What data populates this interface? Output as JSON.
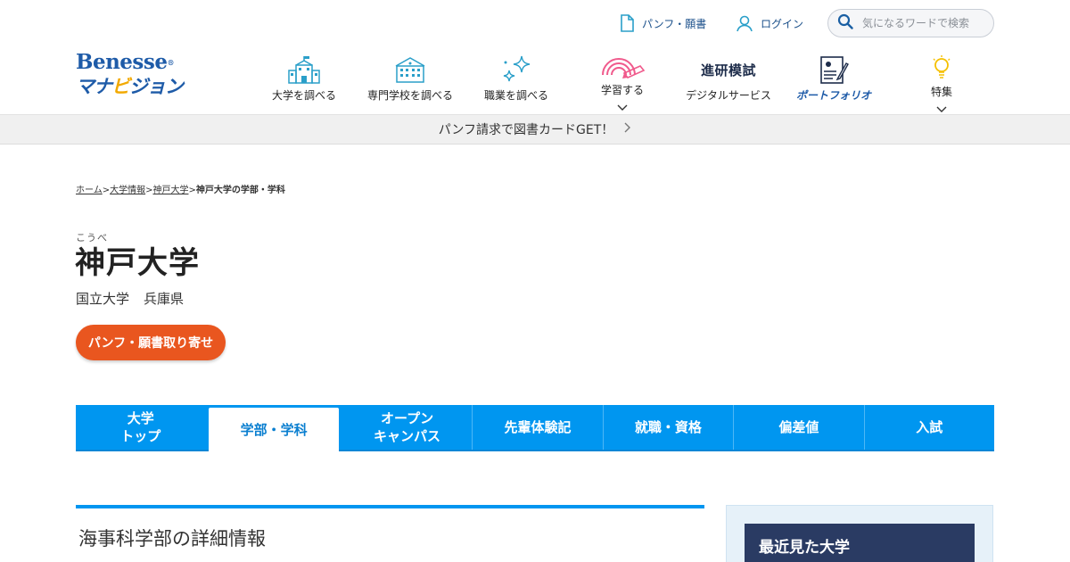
{
  "utility": {
    "pamphlet_label": "パンフ・願書",
    "login_label": "ログイン",
    "search_placeholder": "気になるワードで検索"
  },
  "logo": {
    "top": "Benesse",
    "reg": "®",
    "bottom_a": "マナ",
    "bottom_b": "ビ",
    "bottom_c": "ジョン"
  },
  "nav": {
    "items": [
      {
        "label": "大学を調べる",
        "icon": "school-building-icon"
      },
      {
        "label": "専門学校を調べる",
        "icon": "college-building-icon"
      },
      {
        "label": "職業を調べる",
        "icon": "sparkle-icon"
      },
      {
        "label": "学習する",
        "icon": "rainbow-pencil-icon",
        "dropdown": true
      },
      {
        "label": "デジタルサービス",
        "brand": "進研模試"
      },
      {
        "label": "ポートフォリオ",
        "icon": "portfolio-icon"
      },
      {
        "label": "特集",
        "icon": "lightbulb-icon",
        "dropdown": true
      }
    ]
  },
  "banner": {
    "text": "パンフ請求で図書カードGET！"
  },
  "breadcrumb": {
    "items": [
      "ホーム",
      "大学情報",
      "神戸大学"
    ],
    "current": "神戸大学の学部・学科",
    "separator": ">"
  },
  "university": {
    "ruby": "こうべ",
    "name": "神戸大学",
    "type": "国立大学",
    "prefecture": "兵庫県",
    "cta_label": "パンフ・願書取り寄せ"
  },
  "tabs": [
    {
      "label": "大学\nトップ"
    },
    {
      "label": "学部・学科",
      "active": true
    },
    {
      "label": "オープン\nキャンパス"
    },
    {
      "label": "先輩体験記"
    },
    {
      "label": "就職・資格"
    },
    {
      "label": "偏差値"
    },
    {
      "label": "入試"
    }
  ],
  "section": {
    "title": "海事科学部の詳細情報"
  },
  "sidebar": {
    "recent_title": "最近見た大学"
  },
  "colors": {
    "primary": "#0096f0",
    "brand_blue": "#1e5ba8",
    "cta_orange": "#e9561f",
    "sidebar_head": "#2a3b63",
    "icon_teal": "#2a9fc9"
  }
}
